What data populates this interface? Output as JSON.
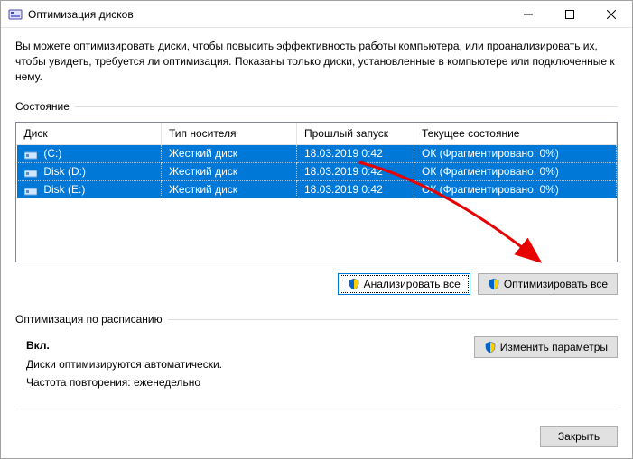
{
  "titlebar": {
    "title": "Оптимизация дисков"
  },
  "intro": "Вы можете оптимизировать диски, чтобы повысить эффективность работы  компьютера, или проанализировать их, чтобы увидеть, требуется ли оптимизация. Показаны только диски, установленные в компьютере или подключенные к нему.",
  "status_label": "Состояние",
  "table": {
    "headers": {
      "disk": "Диск",
      "media": "Тип носителя",
      "last_run": "Прошлый запуск",
      "status": "Текущее состояние"
    },
    "rows": [
      {
        "name": "(C:)",
        "media": "Жесткий диск",
        "last_run": "18.03.2019 0:42",
        "status": "ОК (Фрагментировано: 0%)"
      },
      {
        "name": "Disk (D:)",
        "media": "Жесткий диск",
        "last_run": "18.03.2019 0:42",
        "status": "ОК (Фрагментировано: 0%)"
      },
      {
        "name": "Disk (E:)",
        "media": "Жесткий диск",
        "last_run": "18.03.2019 0:42",
        "status": "ОК (Фрагментировано: 0%)"
      }
    ]
  },
  "buttons": {
    "analyze": "Анализировать все",
    "optimize": "Оптимизировать все",
    "change_settings": "Изменить параметры",
    "close": "Закрыть"
  },
  "schedule": {
    "label": "Оптимизация по расписанию",
    "status": "Вкл.",
    "desc": "Диски оптимизируются автоматически.",
    "frequency": "Частота повторения: еженедельно"
  }
}
